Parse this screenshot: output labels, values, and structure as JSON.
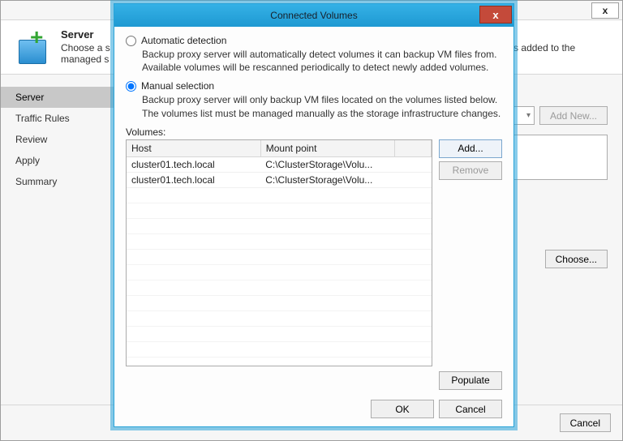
{
  "parent": {
    "close_glyph": "x",
    "header_title": "Server",
    "header_desc_left": "Choose a s",
    "header_desc_right": "ers added to the",
    "header_desc_second": "managed s",
    "nav": [
      "Server",
      "Traffic Rules",
      "Review",
      "Apply",
      "Summary"
    ],
    "nav_active_index": 0,
    "add_new_label": "Add New...",
    "choose_label": "Choose...",
    "cancel_label": "Cancel"
  },
  "modal": {
    "title": "Connected Volumes",
    "close_glyph": "x",
    "option_auto": {
      "label": "Automatic detection",
      "desc": "Backup proxy server will automatically detect volumes it can backup VM files from. Available volumes will be rescanned periodically to detect newly added volumes."
    },
    "option_manual": {
      "label": "Manual selection",
      "desc": "Backup proxy server will only backup VM files located on the volumes listed below. The volumes list must be managed manually as the storage infrastructure changes."
    },
    "selected": "manual",
    "volumes_label": "Volumes:",
    "columns": {
      "host": "Host",
      "mount": "Mount point"
    },
    "rows": [
      {
        "host": "cluster01.tech.local",
        "mount": "C:\\ClusterStorage\\Volu..."
      },
      {
        "host": "cluster01.tech.local",
        "mount": "C:\\ClusterStorage\\Volu..."
      }
    ],
    "buttons": {
      "add": "Add...",
      "remove": "Remove",
      "populate": "Populate",
      "ok": "OK",
      "cancel": "Cancel"
    }
  },
  "chart_data": {
    "type": "table",
    "title": "Volumes",
    "columns": [
      "Host",
      "Mount point"
    ],
    "rows": [
      [
        "cluster01.tech.local",
        "C:\\ClusterStorage\\Volu..."
      ],
      [
        "cluster01.tech.local",
        "C:\\ClusterStorage\\Volu..."
      ]
    ]
  }
}
